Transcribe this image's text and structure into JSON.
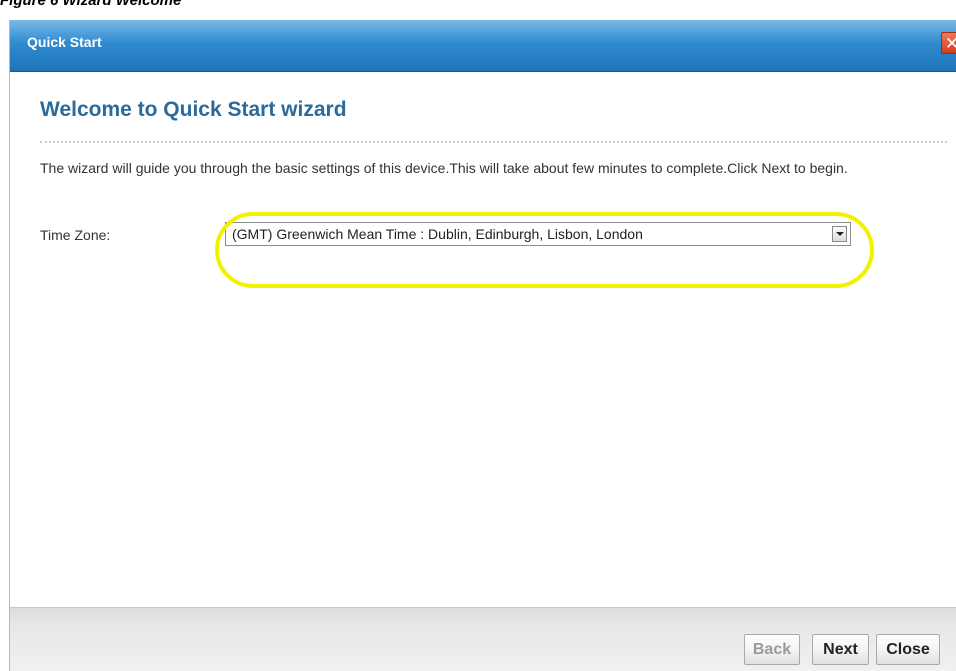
{
  "figure": {
    "caption": "Figure 6   Wizard Welcome"
  },
  "dialog": {
    "title": "Quick Start",
    "close_glyph": "✕"
  },
  "content": {
    "wizard_title": "Welcome to Quick Start wizard",
    "intro_text": "The wizard will guide you through the basic settings of this device.This will take about few minutes to complete.Click Next to begin.",
    "time_zone_label": "Time Zone:",
    "time_zone_value": "(GMT) Greenwich Mean Time : Dublin, Edinburgh, Lisbon, London"
  },
  "footer": {
    "back_label": "Back",
    "next_label": "Next",
    "close_label": "Close"
  },
  "colors": {
    "title_bar": "#2f8bd0",
    "wizard_title": "#2a6b9c",
    "highlight": "#f2f200",
    "close_button": "#d23e1d"
  },
  "icons": {
    "dialog_close": "close-icon",
    "select_arrow": "chevron-down-icon"
  }
}
